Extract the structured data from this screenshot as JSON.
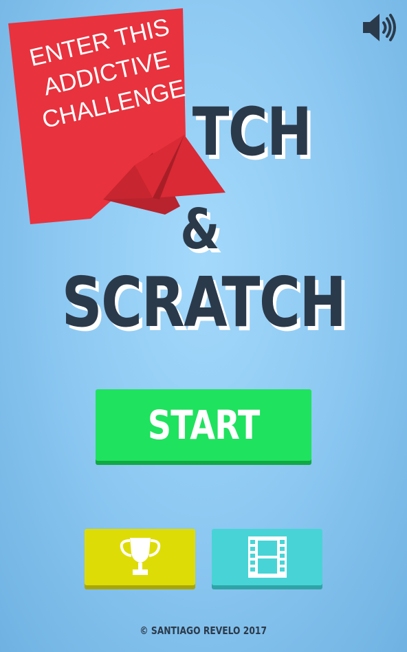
{
  "title": {
    "line1": "TCH",
    "line2": "&",
    "line3": "SCRATCH"
  },
  "ribbon": {
    "lines": [
      "ENTER THIS",
      "ADDICTIVE",
      "CHALLENGE"
    ],
    "color": "#e8323e"
  },
  "buttons": {
    "start_label": "START",
    "trophy_icon": "trophy-icon",
    "film_icon": "film-icon"
  },
  "footer": {
    "copyright": "© SANTIAGO REVELO 2017"
  },
  "icons": {
    "sound": "speaker-volume-icon"
  },
  "colors": {
    "background": "#8fcaf3",
    "title": "#2b3a4a",
    "start": "#1fe25e",
    "trophy_button": "#dedc06",
    "film_button": "#48d4d6",
    "ribbon": "#e8323e"
  }
}
